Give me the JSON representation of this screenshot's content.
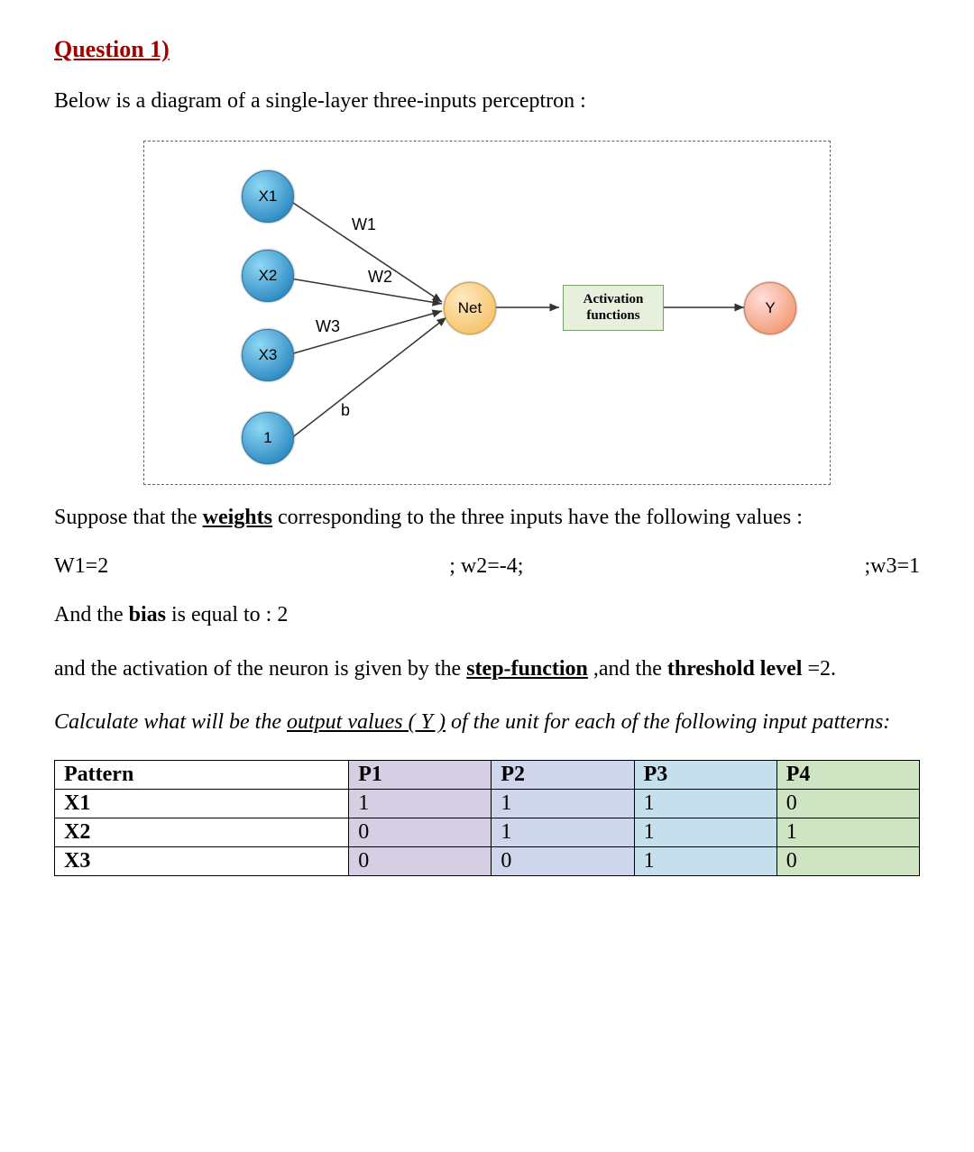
{
  "title": "Question 1)",
  "intro": "Below is a diagram of a single-layer three-inputs perceptron :",
  "diagram": {
    "inputs": [
      "X1",
      "X2",
      "X3",
      "1"
    ],
    "weights": [
      "W1",
      "W2",
      "W3",
      "b"
    ],
    "net": "Net",
    "activation": "Activation functions",
    "activation_line1": "Activation",
    "activation_line2": "functions",
    "output": "Y"
  },
  "suppose_pre": "Suppose that the ",
  "suppose_word": "weights",
  "suppose_post": " corresponding to the three inputs have the following values :",
  "weights_line": {
    "w1": "W1=2",
    "w2": "; w2=-4;",
    "w3": ";w3=1"
  },
  "bias_pre": "And the ",
  "bias_word": "bias",
  "bias_post": " is equal to : 2",
  "activation_pre": "and the activation of the neuron is given by the ",
  "activation_word": "step-function",
  "activation_mid": " ,and the ",
  "threshold_word": "threshold level",
  "threshold_post": " =2.",
  "calc_pre": "Calculate what will be the ",
  "calc_out": "output values",
  "calc_y": " ( Y )",
  "calc_post": " of the unit for each of the following input patterns:",
  "table": {
    "headers": [
      "Pattern",
      "P1",
      "P2",
      "P3",
      "P4"
    ],
    "rows": [
      {
        "label": "X1",
        "cells": [
          "1",
          "1",
          "1",
          "0"
        ]
      },
      {
        "label": "X2",
        "cells": [
          "0",
          "1",
          "1",
          "1"
        ]
      },
      {
        "label": "X3",
        "cells": [
          "0",
          "0",
          "1",
          "0"
        ]
      }
    ]
  }
}
